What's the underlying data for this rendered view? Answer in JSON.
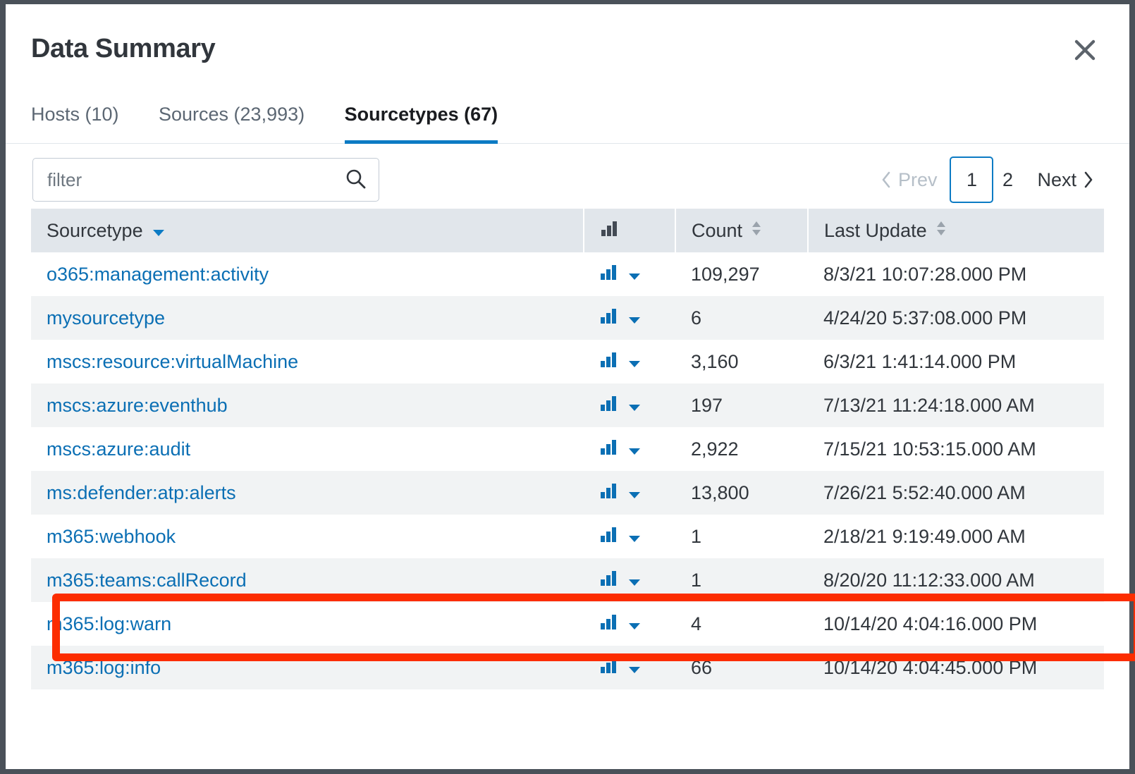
{
  "window": {
    "title": "Data Summary",
    "close_icon": "close-icon"
  },
  "tabs": [
    {
      "label": "Hosts (10)",
      "active": false
    },
    {
      "label": "Sources (23,993)",
      "active": false
    },
    {
      "label": "Sourcetypes (67)",
      "active": true
    }
  ],
  "toolbar": {
    "filter_value": "",
    "filter_placeholder": "filter",
    "search_icon": "search-icon"
  },
  "pagination": {
    "prev_label": "Prev",
    "next_label": "Next",
    "pages": [
      "1",
      "2"
    ],
    "current_page": "1"
  },
  "table": {
    "columns": {
      "sourcetype": "Sourcetype",
      "spark": "",
      "count": "Count",
      "last_update": "Last Update"
    },
    "sort": {
      "column": "Sourcetype",
      "direction": "descending"
    },
    "rows": [
      {
        "sourcetype": "o365:management:activity",
        "count": "109,297",
        "last_update": "8/3/21 10:07:28.000 PM"
      },
      {
        "sourcetype": "mysourcetype",
        "count": "6",
        "last_update": "4/24/20 5:37:08.000 PM"
      },
      {
        "sourcetype": "mscs:resource:virtualMachine",
        "count": "3,160",
        "last_update": "6/3/21 1:41:14.000 PM"
      },
      {
        "sourcetype": "mscs:azure:eventhub",
        "count": "197",
        "last_update": "7/13/21 11:24:18.000 AM"
      },
      {
        "sourcetype": "mscs:azure:audit",
        "count": "2,922",
        "last_update": "7/15/21 10:53:15.000 AM"
      },
      {
        "sourcetype": "ms:defender:atp:alerts",
        "count": "13,800",
        "last_update": "7/26/21 5:52:40.000 AM"
      },
      {
        "sourcetype": "m365:webhook",
        "count": "1",
        "last_update": "2/18/21 9:19:49.000 AM"
      },
      {
        "sourcetype": "m365:teams:callRecord",
        "count": "1",
        "last_update": "8/20/20 11:12:33.000 AM"
      },
      {
        "sourcetype": "m365:log:warn",
        "count": "4",
        "last_update": "10/14/20 4:04:16.000 PM"
      },
      {
        "sourcetype": "m365:log:info",
        "count": "66",
        "last_update": "10/14/20 4:04:45.000 PM"
      }
    ]
  },
  "annotation": {
    "type": "red-highlight-rectangle",
    "target_row": "mscs:azure:eventhub",
    "color": "#fc2d00"
  },
  "colors": {
    "accent": "#0c7bc4",
    "link": "#0b6fb4",
    "header_bg": "#e1e6eb",
    "stripe": "#f1f3f4",
    "text": "#31363c"
  }
}
